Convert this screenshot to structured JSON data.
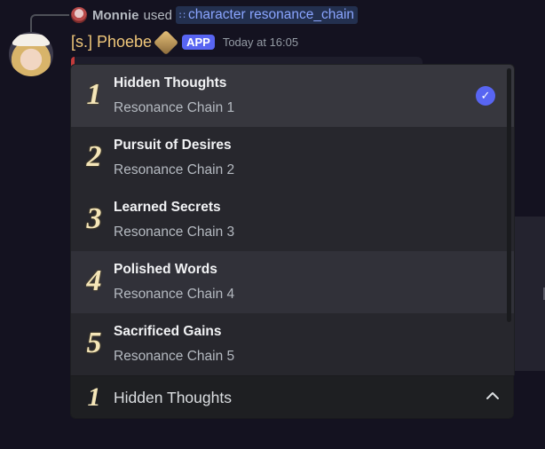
{
  "reply": {
    "user": "Monnie",
    "used_text": "used",
    "command": "character resonance_chain"
  },
  "author": {
    "name": "[s.] Phoebe",
    "badge": "APP",
    "timestamp": "Today at 16:05"
  },
  "menu": {
    "options": [
      {
        "number": "1",
        "label": "Hidden Thoughts",
        "description": "Resonance Chain 1"
      },
      {
        "number": "2",
        "label": "Pursuit of Desires",
        "description": "Resonance Chain 2"
      },
      {
        "number": "3",
        "label": "Learned Secrets",
        "description": "Resonance Chain 3"
      },
      {
        "number": "4",
        "label": "Polished Words",
        "description": "Resonance Chain 4"
      },
      {
        "number": "5",
        "label": "Sacrificed Gains",
        "description": "Resonance Chain 5"
      }
    ]
  },
  "select": {
    "number": "1",
    "value": "Hidden Thoughts"
  },
  "colors": {
    "accent": "#5865f2",
    "author_name": "#f0c77a",
    "command": "#8aa5ff"
  },
  "icons": {
    "check": "checkmark-icon",
    "chevron": "chevron-up-icon",
    "command": "slash-command-icon"
  }
}
